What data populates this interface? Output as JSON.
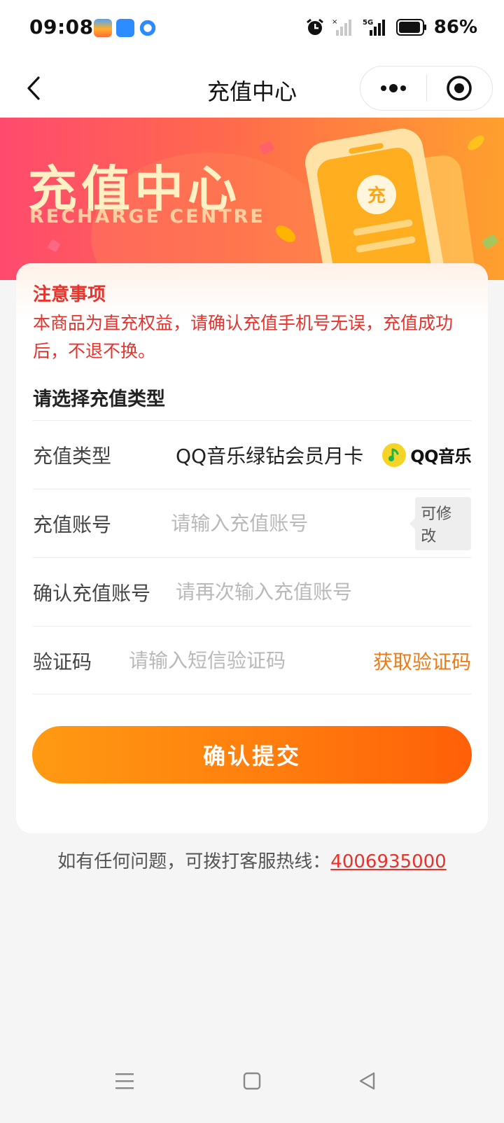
{
  "status_bar": {
    "time": "09:08",
    "battery": "86%",
    "network": "5G"
  },
  "title_bar": {
    "title": "充值中心"
  },
  "banner": {
    "title": "充值中心",
    "subtitle": "RECHARGE CENTRE",
    "phone_badge": "充"
  },
  "notice": {
    "title": "注意事项",
    "text": "本商品为直充权益，请确认充值手机号无误，充值成功后，不退不换。"
  },
  "form": {
    "section_title": "请选择充值类型",
    "type": {
      "label": "充值类型",
      "value": "QQ音乐绿钻会员月卡",
      "brand": "QQ音乐"
    },
    "account": {
      "label": "充值账号",
      "placeholder": "请输入充值账号",
      "badge": "可修改"
    },
    "confirm_account": {
      "label": "确认充值账号",
      "placeholder": "请再次输入充值账号"
    },
    "code": {
      "label": "验证码",
      "placeholder": "请输入短信验证码",
      "action": "获取验证码"
    },
    "submit": "确认提交"
  },
  "footer": {
    "hotline_text": "如有任何问题，可拨打客服热线：",
    "hotline_number": "4006935000"
  },
  "colors": {
    "accent": "#ff7d0e",
    "warning": "#e8322c",
    "link": "#ee7a17"
  }
}
